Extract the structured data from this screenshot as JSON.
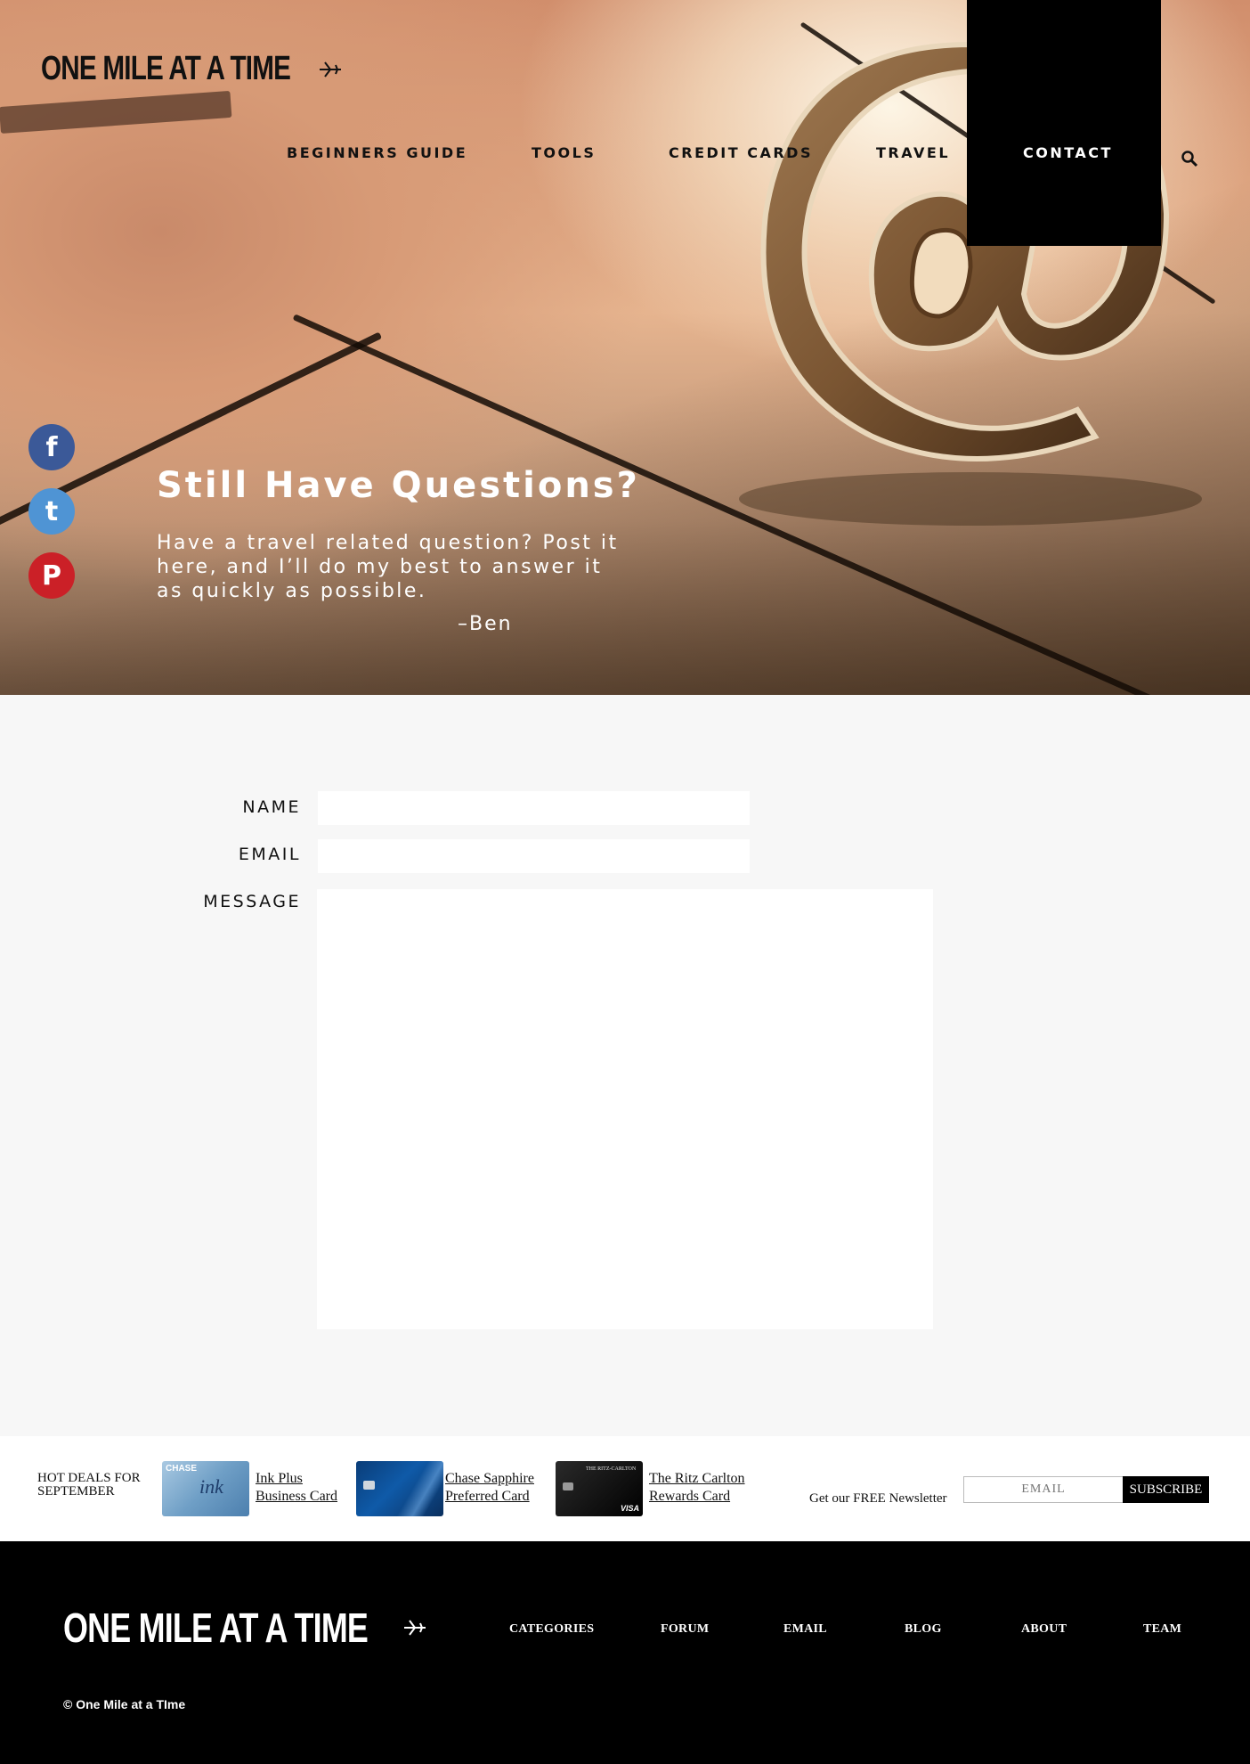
{
  "brand": {
    "logo_text": "ONE MILE AT A TIME"
  },
  "nav": {
    "items": [
      {
        "label": "BEGINNERS GUIDE"
      },
      {
        "label": "TOOLS"
      },
      {
        "label": "CREDIT CARDS"
      },
      {
        "label": "TRAVEL"
      },
      {
        "label": "CONTACT",
        "active": true
      }
    ],
    "search_icon": "search-icon"
  },
  "social": [
    {
      "name": "facebook",
      "glyph": "f",
      "color": "#3b5998"
    },
    {
      "name": "twitter",
      "glyph": "t",
      "color": "#4f94d4"
    },
    {
      "name": "pinterest",
      "glyph": "P",
      "color": "#cb2027"
    }
  ],
  "hero": {
    "title": "Still Have Questions?",
    "subtitle": "Have a travel related question? Post it here, and I’ll do my best to answer it as quickly as possible.",
    "signature": "–Ben"
  },
  "form": {
    "name_label": "NAME",
    "email_label": "EMAIL",
    "message_label": "MESSAGE",
    "name_value": "",
    "email_value": "",
    "message_value": ""
  },
  "deals": {
    "heading_line1": "HOT DEALS FOR",
    "heading_line2": "SEPTEMBER",
    "cards": [
      {
        "line1": "Ink Plus",
        "line2": "Business Card",
        "brand_text": "CHASE",
        "card_text": "ink"
      },
      {
        "line1": "Chase Sapphire",
        "line2": "Preferred Card"
      },
      {
        "line1": "The Ritz Carlton",
        "line2": "Rewards Card",
        "brand_text": "THE RITZ-CARLTON",
        "network": "VISA"
      }
    ],
    "newsletter_label": "Get our FREE Newsletter",
    "email_placeholder": "EMAIL",
    "subscribe_label": "SUBSCRIBE"
  },
  "footer": {
    "links": [
      {
        "label": "CATEGORIES"
      },
      {
        "label": "FORUM"
      },
      {
        "label": "EMAIL"
      },
      {
        "label": "BLOG"
      },
      {
        "label": "ABOUT"
      },
      {
        "label": "TEAM"
      }
    ],
    "copyright": "© One Mile at a TIme"
  },
  "colors": {
    "nav_active_bg": "#000000",
    "facebook": "#3b5998",
    "twitter": "#4f94d4",
    "pinterest": "#cb2027",
    "form_bg": "#f7f7f7",
    "footer_bg": "#000000"
  }
}
